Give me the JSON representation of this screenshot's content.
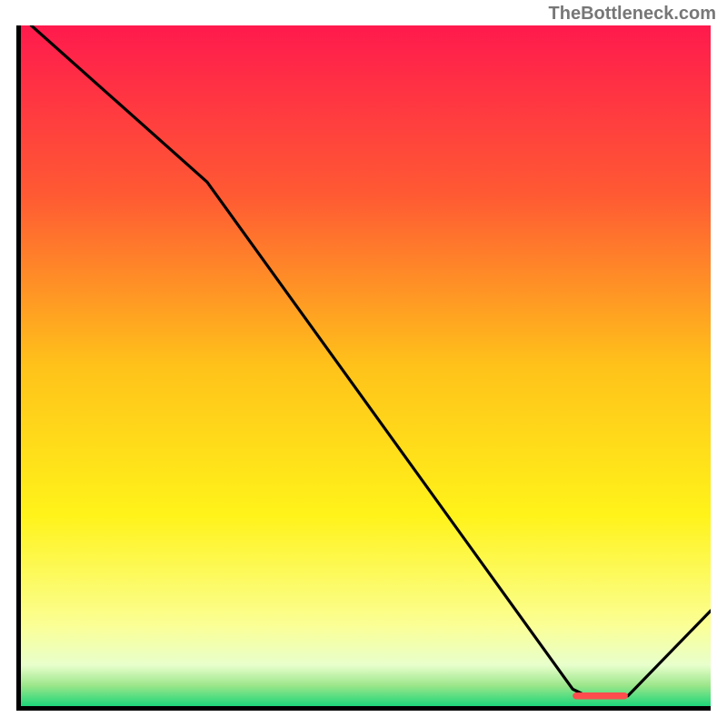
{
  "watermark": "TheBottleneck.com",
  "chart_data": {
    "type": "line",
    "title": "",
    "xlabel": "",
    "ylabel": "",
    "xlim": [
      0,
      100
    ],
    "ylim": [
      0,
      100
    ],
    "gradient_stops": [
      {
        "pos": 0.0,
        "color": "#ff1a4d"
      },
      {
        "pos": 0.25,
        "color": "#ff5a33"
      },
      {
        "pos": 0.5,
        "color": "#ffc21a"
      },
      {
        "pos": 0.72,
        "color": "#fff31a"
      },
      {
        "pos": 0.88,
        "color": "#fbff94"
      },
      {
        "pos": 0.94,
        "color": "#e8ffcc"
      },
      {
        "pos": 0.97,
        "color": "#9be68a"
      },
      {
        "pos": 1.0,
        "color": "#1dd67a"
      }
    ],
    "series": [
      {
        "name": "curve",
        "points": [
          {
            "x": 1.5,
            "y": 100.0
          },
          {
            "x": 27.0,
            "y": 77.0
          },
          {
            "x": 80.0,
            "y": 2.5
          },
          {
            "x": 82.0,
            "y": 1.5
          },
          {
            "x": 88.0,
            "y": 1.5
          },
          {
            "x": 100.0,
            "y": 14.0
          }
        ]
      },
      {
        "name": "marker",
        "style": "rect",
        "color": "#ff4d4d",
        "rect": {
          "x1": 80.0,
          "x2": 88.0,
          "y": 1.5,
          "h": 1.0
        }
      }
    ]
  }
}
